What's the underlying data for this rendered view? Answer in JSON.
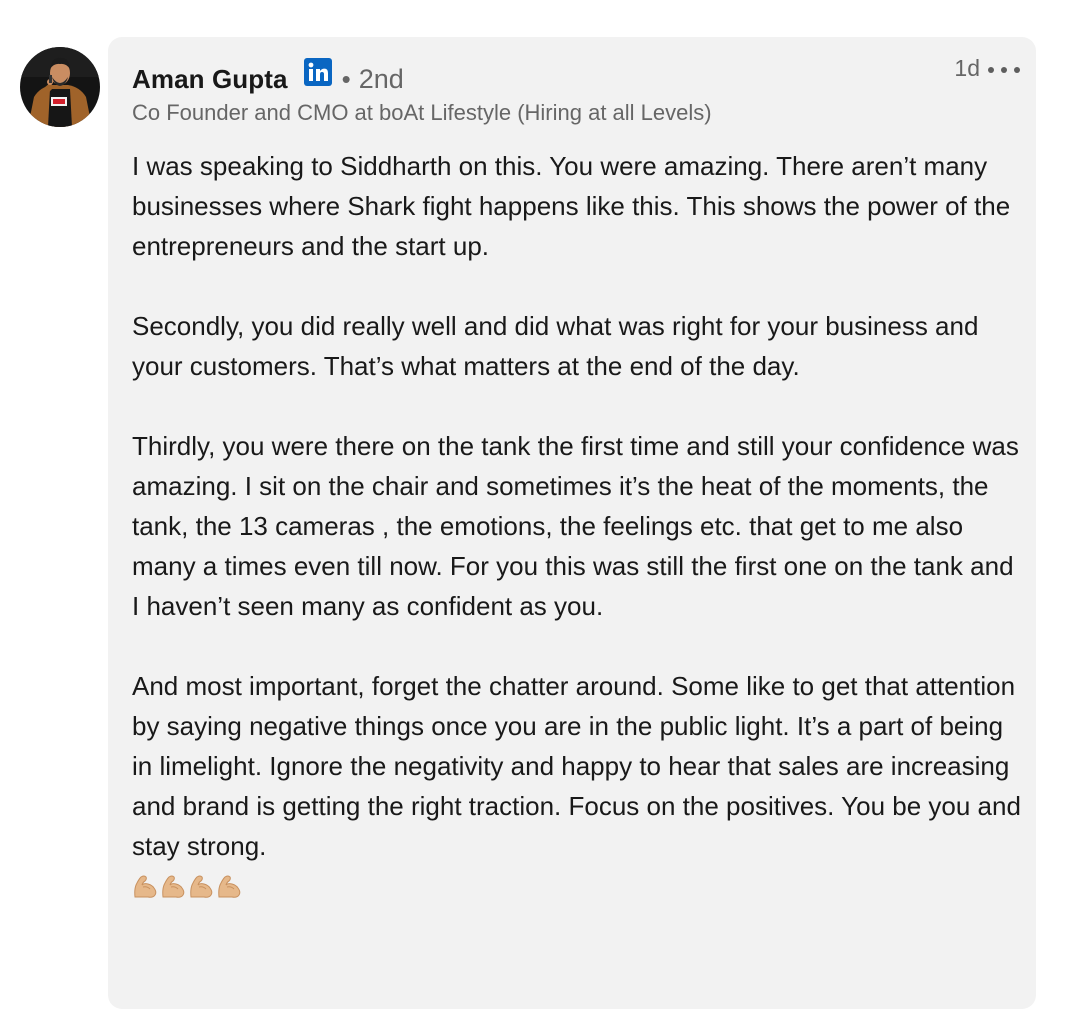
{
  "comment": {
    "author": {
      "name": "Aman Gupta",
      "degree_separator": "•",
      "degree": "2nd",
      "headline": "Co Founder and CMO at boAt Lifestyle (Hiring at all Levels)",
      "avatar_icon": "profile-photo",
      "badge_icon": "linkedin-icon"
    },
    "timestamp": "1d",
    "more_icon": "more-horizontal-icon",
    "paragraphs": [
      "I was speaking to Siddharth on this. You were amazing. There aren’t many businesses where Shark fight happens like this. This shows the power of the entrepreneurs and the start up.",
      "Secondly, you did really well and did what was right for your business and your customers. That’s what matters at the end of the day.",
      "Thirdly, you were there on the tank the first time and still your confidence was amazing. I sit on the chair and sometimes it’s the heat of the moments, the tank, the 13 cameras , the emotions, the feelings etc. that get to me also many a times even till now. For you this was still the first one on the tank and I haven’t seen many as confident as you.",
      "And most important, forget the chatter around. Some like to get that attention by saying negative things once you are in the public light. It’s a part of being in limelight. Ignore the negativity and happy to hear that sales are increasing and brand is getting the right traction. Focus on the positives. You be you and stay strong."
    ],
    "emoji": {
      "icon": "flexed-biceps-emoji",
      "count": 4
    },
    "colors": {
      "bubble_bg": "#f2f2f2",
      "linkedin_blue": "#0a66c2",
      "secondary_text": "#666666",
      "primary_text": "#191919"
    }
  }
}
